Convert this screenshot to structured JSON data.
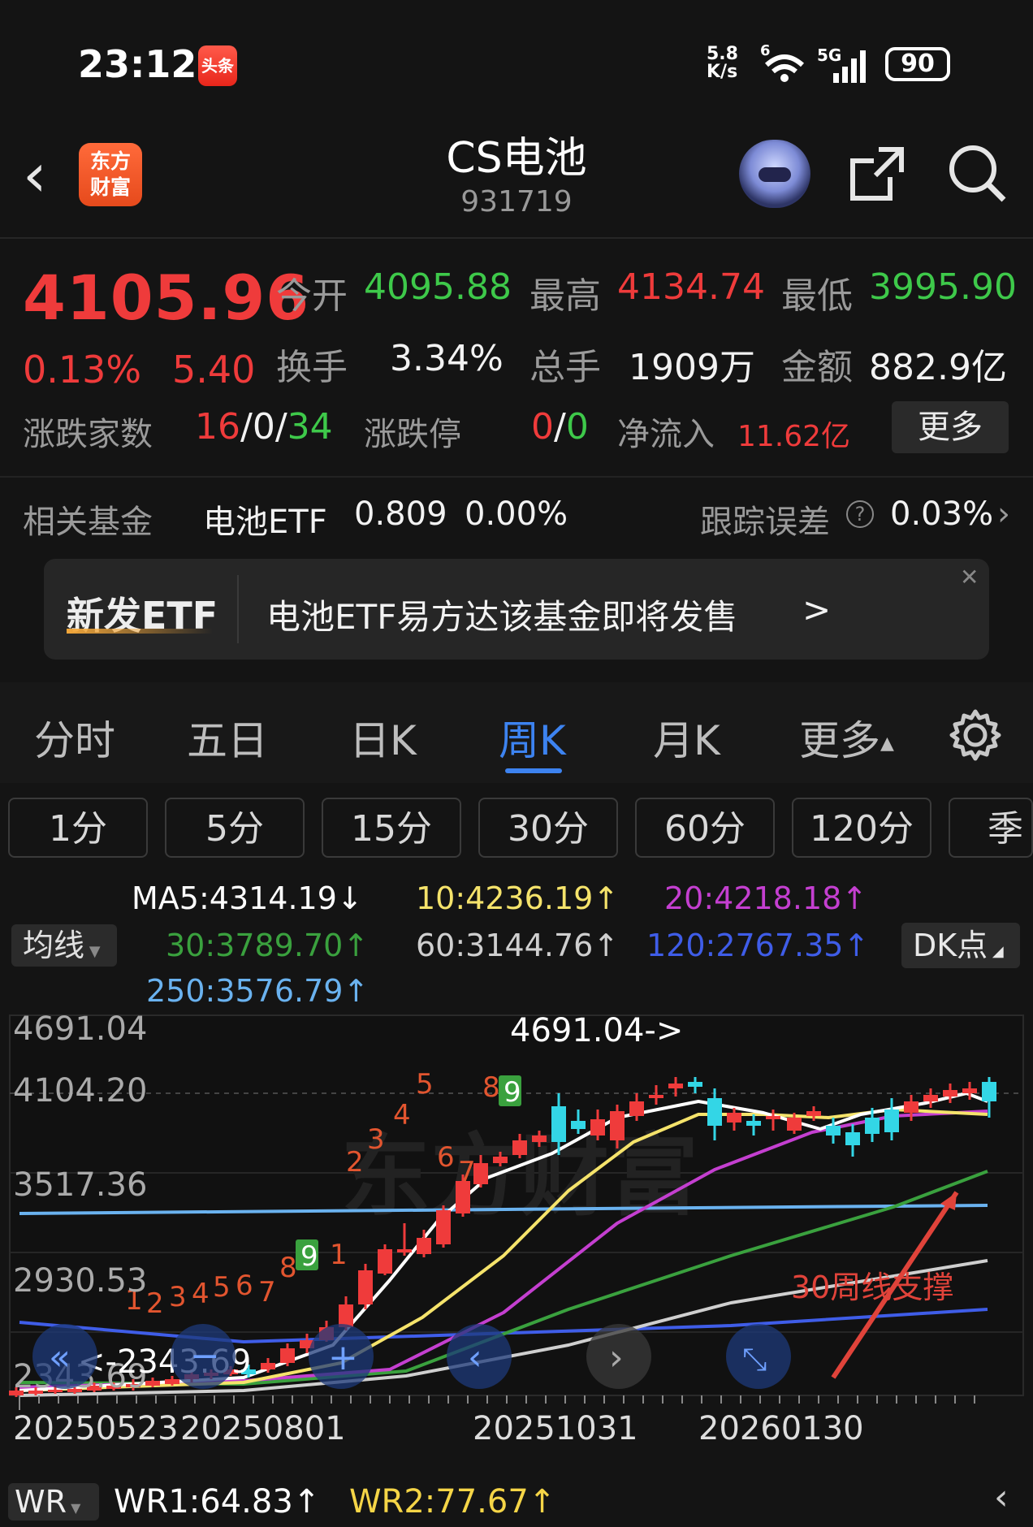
{
  "status": {
    "time": "23:12",
    "app_badge": "头条",
    "net_speed_top": "5.8",
    "net_speed_bottom": "K/s",
    "wifi_badge": "6",
    "cell_type": "5G",
    "battery": "90"
  },
  "header": {
    "app_logo_line1": "东方",
    "app_logo_line2": "财富",
    "title": "CS电池",
    "code": "931719"
  },
  "quote": {
    "price": "4105.96",
    "change_pct": "0.13%",
    "change_amt": "5.40",
    "open_label": "今开",
    "open": "4095.88",
    "high_label": "最高",
    "high": "4134.74",
    "low_label": "最低",
    "low": "3995.90",
    "turnover_label": "换手",
    "turnover": "3.34%",
    "volume_label": "总手",
    "volume": "1909万",
    "amount_label": "金额",
    "amount": "882.9亿",
    "breadth_label": "涨跌家数",
    "breadth_up": "16",
    "breadth_sep1": "/",
    "breadth_flat": "0",
    "breadth_sep2": "/",
    "breadth_down": "34",
    "limit_label": "涨跌停",
    "limit_up": "0",
    "limit_sep": "/",
    "limit_down": "0",
    "inflow_label": "净流入",
    "inflow": "11.62亿",
    "more": "更多"
  },
  "fund": {
    "label": "相关基金",
    "name": "电池ETF",
    "price": "0.809",
    "pct": "0.00%",
    "tracking_label": "跟踪误差",
    "tracking": "0.03%"
  },
  "promo": {
    "tag": "新发ETF",
    "text": "电池ETF易方达该基金即将发售",
    "arrow": ">"
  },
  "tabs": [
    "分时",
    "五日",
    "日K",
    "周K",
    "月K",
    "更多"
  ],
  "active_tab": "周K",
  "periods": [
    "1分",
    "5分",
    "15分",
    "30分",
    "60分",
    "120分",
    "季K"
  ],
  "indicators": {
    "selector": "均线",
    "dk": "DK点",
    "ma5": "MA5:4314.19↓",
    "ma10": "10:4236.19↑",
    "ma20": "20:4218.18↑",
    "ma30": "30:3789.70↑",
    "ma60": "60:3144.76↑",
    "ma120": "120:2767.35↑",
    "ma250": "250:3576.79↑"
  },
  "colors": {
    "up": "#ef3b3b",
    "down": "#33d6e6",
    "accent": "#3d83f0",
    "ma5": "#ffffff",
    "ma10": "#f5e36b",
    "ma20": "#c43fd0",
    "ma30": "#3aa13e",
    "ma60": "#cfcfcf",
    "ma120": "#3f5de8",
    "ma250": "#6ab2ef"
  },
  "chart": {
    "y_labels": [
      "4691.04",
      "4104.20",
      "3517.36",
      "2930.53",
      "2343.69"
    ],
    "x_labels": [
      "20250523",
      "20250801",
      "20251031",
      "20260130"
    ],
    "high_marker": "4691.04->",
    "low_marker": "<-2343.69",
    "annotation": "30周线支撑",
    "seq_upper": [
      "1",
      "2",
      "3",
      "4",
      "5",
      "6",
      "7",
      "8",
      "9"
    ],
    "seq_lower": [
      "1",
      "2",
      "3",
      "4",
      "5",
      "6",
      "7",
      "8",
      "9"
    ],
    "seq_extra": "1",
    "watermark": "东方财富"
  },
  "wr": {
    "selector": "WR",
    "wr1": "WR1:64.83↑",
    "wr2": "WR2:77.67↑"
  }
}
